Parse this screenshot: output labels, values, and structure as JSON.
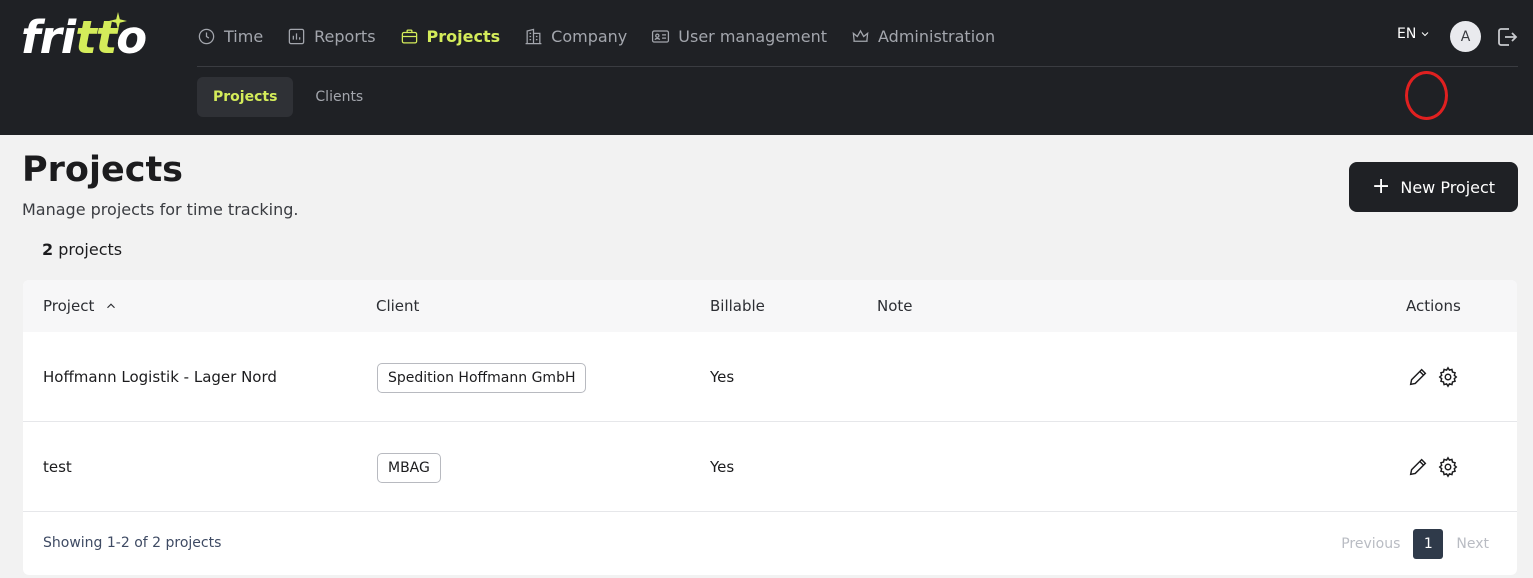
{
  "brand": {
    "logo_text_pre": "fri",
    "logo_text_accent": "tt",
    "logo_text_post": "o",
    "accent_color": "#d4ec5a"
  },
  "nav": {
    "items": [
      {
        "label": "Time",
        "icon": "clock-icon"
      },
      {
        "label": "Reports",
        "icon": "chart-icon"
      },
      {
        "label": "Projects",
        "icon": "briefcase-icon",
        "active": true
      },
      {
        "label": "Company",
        "icon": "building-icon"
      },
      {
        "label": "User management",
        "icon": "id-card-icon"
      },
      {
        "label": "Administration",
        "icon": "crown-icon"
      }
    ],
    "language": "EN",
    "avatar_initial": "A"
  },
  "subnav": {
    "items": [
      {
        "label": "Projects",
        "active": true
      },
      {
        "label": "Clients"
      }
    ]
  },
  "page": {
    "title": "Projects",
    "subtitle": "Manage projects for time tracking.",
    "new_button": "New Project",
    "count_number": "2",
    "count_label": " projects"
  },
  "table": {
    "headers": {
      "project": "Project",
      "client": "Client",
      "billable": "Billable",
      "note": "Note",
      "actions": "Actions"
    },
    "rows": [
      {
        "project": "Hoffmann Logistik - Lager Nord",
        "client": "Spedition Hoffmann GmbH",
        "billable": "Yes",
        "note": ""
      },
      {
        "project": "test",
        "client": "MBAG",
        "billable": "Yes",
        "note": ""
      }
    ],
    "showing": "Showing 1-2 of 2 projects",
    "pagination": {
      "previous": "Previous",
      "current": "1",
      "next": "Next"
    }
  }
}
